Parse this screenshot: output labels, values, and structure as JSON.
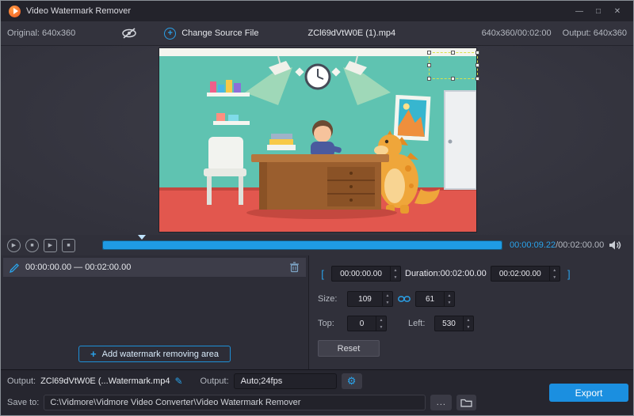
{
  "titlebar": {
    "title": "Video Watermark Remover"
  },
  "icons": {
    "minimize": "—",
    "maximize": "□",
    "close": "✕",
    "plus": "+",
    "play": "▶",
    "stop": "■",
    "up": "▲",
    "down": "▼",
    "pencil": "✎",
    "gear": "⚙",
    "dots": "..."
  },
  "toolbar": {
    "original": "Original: 640x360",
    "change_source": "Change Source File",
    "filename": "ZCl69dVtW0E (1).mp4",
    "dimensions_duration": "640x360/00:02:00",
    "output": "Output: 640x360"
  },
  "transport": {
    "current_time": "00:00:09.22",
    "total_time": "/00:02:00.00"
  },
  "watermark_panel": {
    "range": "00:00:00.00 — 00:02:00.00",
    "add_area_label": "Add watermark removing area"
  },
  "properties_panel": {
    "bracket_left": "[",
    "bracket_right": "]",
    "start_time": "00:00:00.00",
    "duration": "Duration:00:02:00.00",
    "end_time": "00:02:00.00",
    "size_label": "Size:",
    "width": "109",
    "height": "61",
    "top_label": "Top:",
    "top": "0",
    "left_label": "Left:",
    "left": "530",
    "reset": "Reset"
  },
  "output_bar": {
    "output_label": "Output:",
    "output_name": "ZCl69dVtW0E (...Watermark.mp4",
    "format_label": "Output:",
    "format_value": "Auto;24fps",
    "export": "Export"
  },
  "save_bar": {
    "label": "Save to:",
    "path": "C:\\Vidmore\\Vidmore Video Converter\\Video Watermark Remover"
  },
  "colors": {
    "accent": "#1b8fe0",
    "timeline": "#1f9be4",
    "selection": "#d9e24b",
    "arrow": "#ffe400"
  }
}
